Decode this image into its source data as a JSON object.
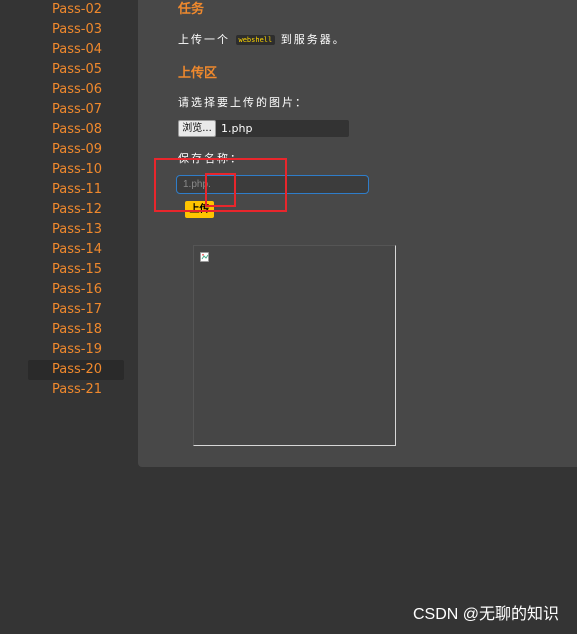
{
  "sidebar": {
    "items": [
      {
        "label": "Pass-02"
      },
      {
        "label": "Pass-03"
      },
      {
        "label": "Pass-04"
      },
      {
        "label": "Pass-05"
      },
      {
        "label": "Pass-06"
      },
      {
        "label": "Pass-07"
      },
      {
        "label": "Pass-08"
      },
      {
        "label": "Pass-09"
      },
      {
        "label": "Pass-10"
      },
      {
        "label": "Pass-11"
      },
      {
        "label": "Pass-12"
      },
      {
        "label": "Pass-13"
      },
      {
        "label": "Pass-14"
      },
      {
        "label": "Pass-15"
      },
      {
        "label": "Pass-16"
      },
      {
        "label": "Pass-17"
      },
      {
        "label": "Pass-18"
      },
      {
        "label": "Pass-19"
      },
      {
        "label": "Pass-20"
      },
      {
        "label": "Pass-21"
      }
    ],
    "active": "Pass-20"
  },
  "main": {
    "task_heading": "任务",
    "task_prefix": "上传一个",
    "task_code": "webshell",
    "task_suffix": "到服务器。",
    "upload_heading": "上传区",
    "choose_label": "请选择要上传的图片：",
    "browse_label": "浏览...",
    "file_name": "1.php",
    "save_label": "保存名称：",
    "save_value": "1.php.",
    "upload_button": "上传"
  },
  "watermark": "CSDN @无聊的知识",
  "colors": {
    "accent": "#f0892d",
    "button": "#ffc400",
    "input_border": "#2f7dc9",
    "annotation": "#e8262c"
  },
  "icons": {
    "preview": "broken-image-icon"
  }
}
